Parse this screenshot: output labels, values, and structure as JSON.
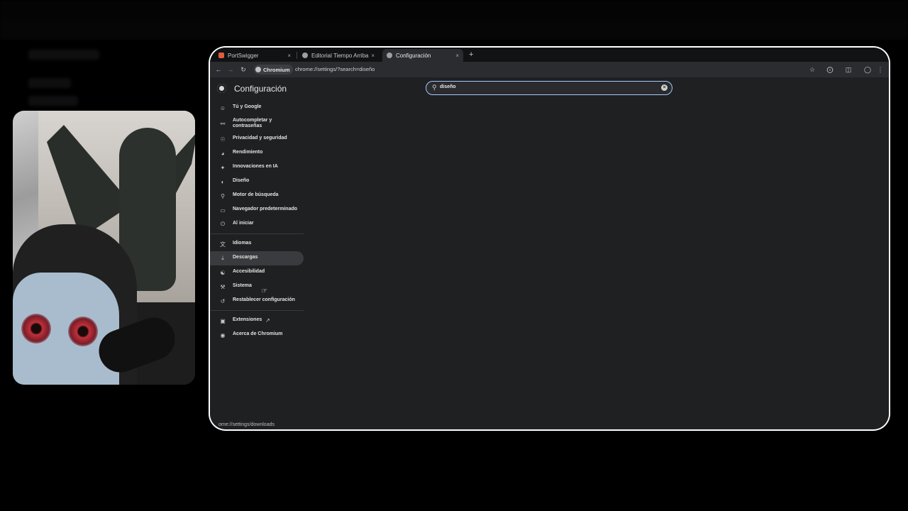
{
  "browser": {
    "tabs": [
      {
        "label": "PortSwigger",
        "favicon_color": "#e25c3a",
        "active": false
      },
      {
        "label": "Editorial Tiempo Arriba",
        "favicon_color": "#9aa0a6",
        "active": false
      },
      {
        "label": "Configuración",
        "favicon_color": "#9aa0a6",
        "active": true
      }
    ],
    "tab_close_glyph": "×",
    "new_tab_glyph": "+",
    "chip_label": "Chromium",
    "url": "chrome://settings/?search=diseño",
    "status_url": "ome://settings/downloads"
  },
  "icons": {
    "back": "back-arrow-icon",
    "forward": "forward-arrow-icon",
    "reload": "reload-icon",
    "star": "bookmark-star-icon",
    "extensions": "extensions-icon",
    "sidepanel": "side-panel-icon",
    "profile": "profile-icon",
    "menu": "kebab-menu-icon"
  },
  "settings": {
    "title": "Configuración",
    "search_value": "diseño",
    "menu_group1": [
      {
        "label": "Tú y Google",
        "icon": "person-icon"
      },
      {
        "label": "Autocompletar y contraseñas",
        "icon": "key-icon"
      },
      {
        "label": "Privacidad y seguridad",
        "icon": "shield-icon"
      },
      {
        "label": "Rendimiento",
        "icon": "speedometer-icon"
      },
      {
        "label": "Innovaciones en IA",
        "icon": "sparkle-icon"
      },
      {
        "label": "Diseño",
        "icon": "palette-icon"
      },
      {
        "label": "Motor de búsqueda",
        "icon": "search-icon"
      },
      {
        "label": "Navegador predeterminado",
        "icon": "browser-window-icon"
      },
      {
        "label": "Al iniciar",
        "icon": "power-icon"
      }
    ],
    "menu_group2": [
      {
        "label": "Idiomas",
        "icon": "translate-icon"
      },
      {
        "label": "Descargas",
        "icon": "download-icon"
      },
      {
        "label": "Accesibilidad",
        "icon": "accessibility-icon"
      },
      {
        "label": "Sistema",
        "icon": "wrench-icon"
      },
      {
        "label": "Restablecer configuración",
        "icon": "reset-icon"
      }
    ],
    "menu_group3": [
      {
        "label": "Extensiones",
        "icon": "puzzle-icon"
      },
      {
        "label": "Acerca de Chromium",
        "icon": "chromium-icon"
      }
    ]
  },
  "colors": {
    "accent_focus": "#a8c7fa",
    "background": "#1f2022",
    "hover_item": "#3a3b3e"
  }
}
